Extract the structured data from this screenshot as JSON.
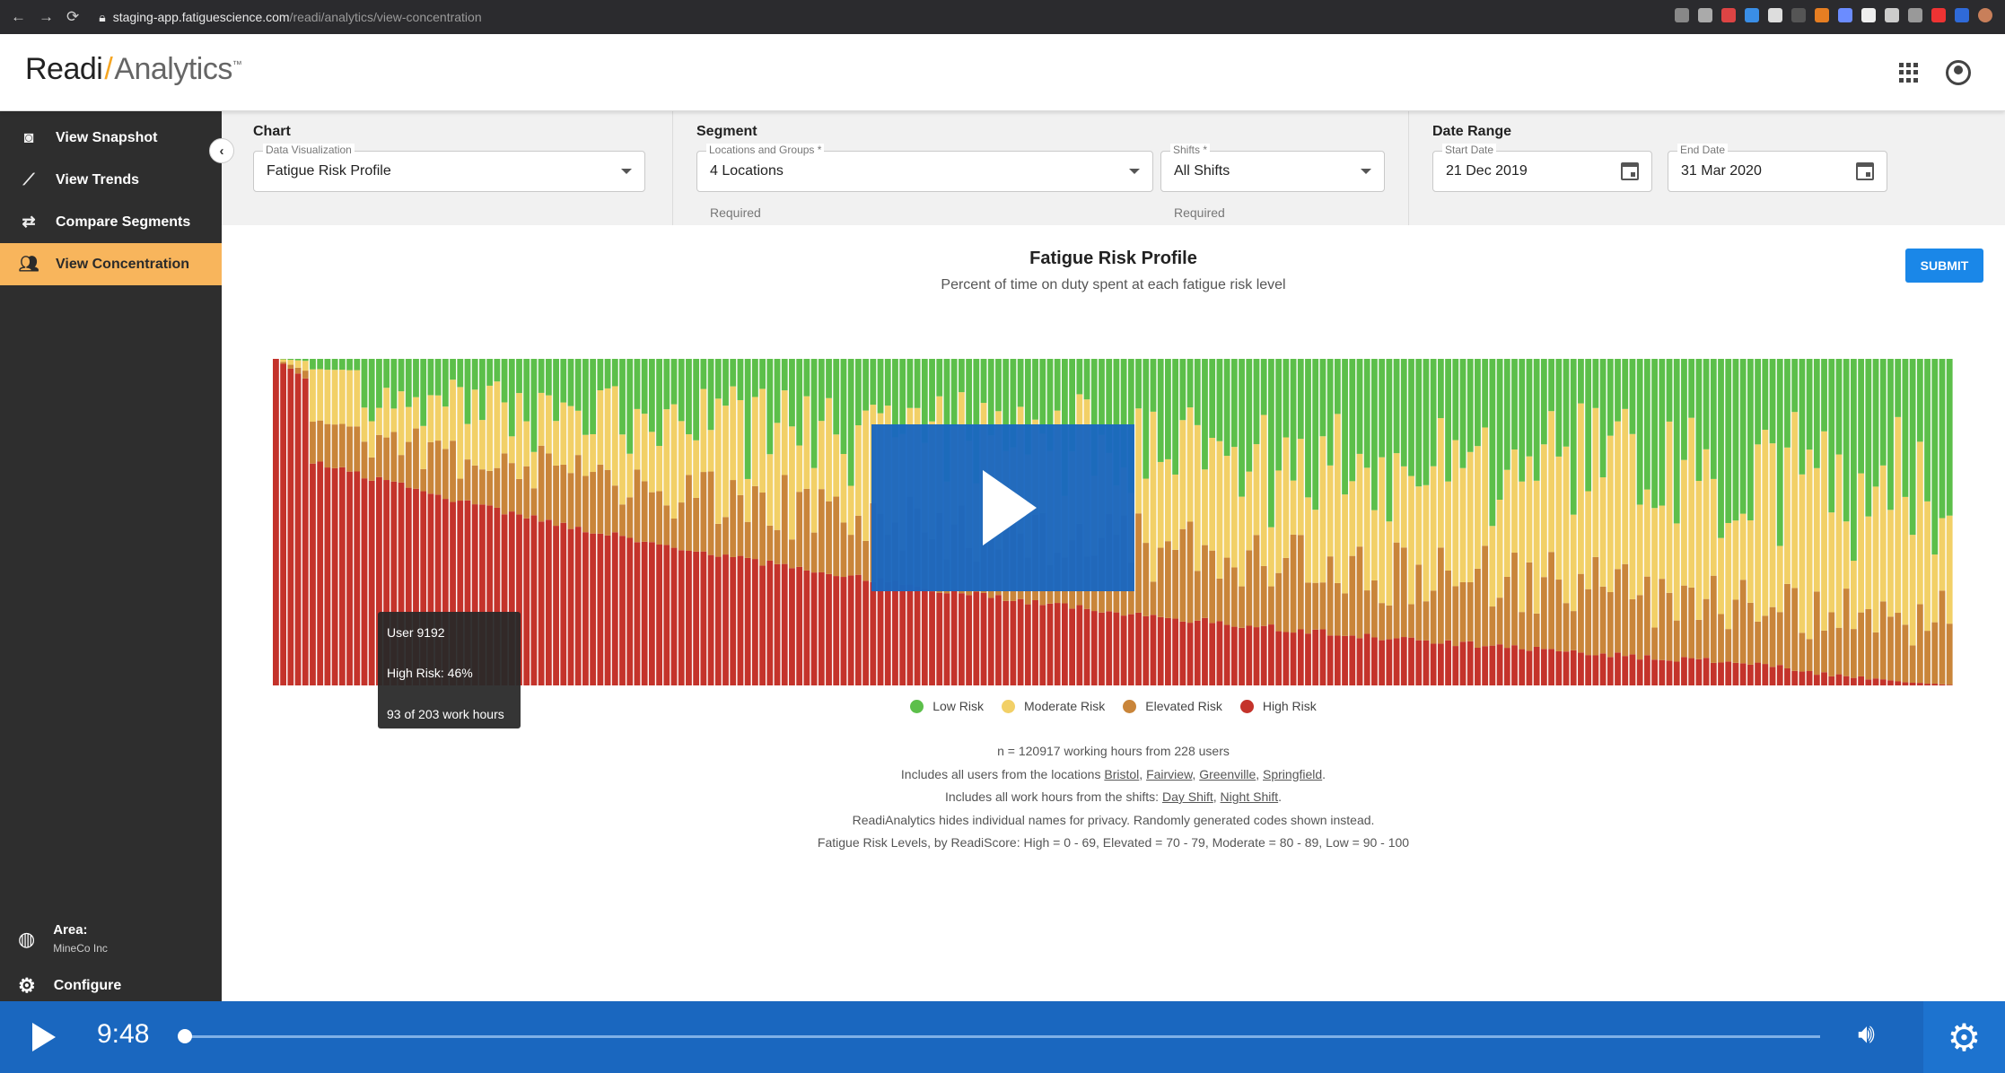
{
  "browser": {
    "url_host": "staging-app.fatiguescience.com",
    "url_path": "/readi/analytics/view-concentration"
  },
  "header": {
    "logo_readi": "Readi",
    "logo_analytics": "Analytics",
    "logo_tm": "™"
  },
  "sidebar": {
    "items": [
      {
        "label": "View Snapshot",
        "icon": "camera-icon"
      },
      {
        "label": "View Trends",
        "icon": "trend-icon"
      },
      {
        "label": "Compare Segments",
        "icon": "compare-icon"
      },
      {
        "label": "View Concentration",
        "icon": "people-icon",
        "active": true
      }
    ],
    "area_label": "Area:",
    "area_value": "MineCo Inc",
    "configure_label": "Configure"
  },
  "filters": {
    "chart": {
      "title": "Chart",
      "data_visualization_label": "Data Visualization",
      "data_visualization_value": "Fatigue Risk Profile"
    },
    "segment": {
      "title": "Segment",
      "locations_label": "Locations and Groups *",
      "locations_value": "4 Locations",
      "locations_helper": "Required",
      "shifts_label": "Shifts *",
      "shifts_value": "All Shifts",
      "shifts_helper": "Required"
    },
    "date_range": {
      "title": "Date Range",
      "start_label": "Start Date",
      "start_value": "21 Dec 2019",
      "end_label": "End Date",
      "end_value": "31 Mar 2020"
    }
  },
  "submit_label": "SUBMIT",
  "chart_data": {
    "type": "bar",
    "stacked": true,
    "title": "Fatigue Risk Profile",
    "subtitle": "Percent of time on duty spent at each fatigue risk level",
    "ylim": [
      0,
      100
    ],
    "user_count": 228,
    "high_risk_trend": {
      "start": 100,
      "tooltip_user_high": 46,
      "end": 0
    },
    "series": [
      {
        "name": "High Risk",
        "color": "#c4332b"
      },
      {
        "name": "Elevated Risk",
        "color": "#c9853a"
      },
      {
        "name": "Moderate Risk",
        "color": "#f2d067"
      },
      {
        "name": "Low Risk",
        "color": "#5cbf4a"
      }
    ],
    "legend_position": "bottom-center"
  },
  "legend": [
    {
      "label": "Low Risk",
      "color": "#5cbf4a"
    },
    {
      "label": "Moderate Risk",
      "color": "#f2d067"
    },
    {
      "label": "Elevated Risk",
      "color": "#c9853a"
    },
    {
      "label": "High Risk",
      "color": "#c4332b"
    }
  ],
  "notes": {
    "line1": "n = 120917 working hours from 228 users",
    "line2_prefix": "Includes all users from the locations",
    "locations": [
      "Bristol",
      "Fairview",
      "Greenville",
      "Springfield"
    ],
    "line3_prefix": "Includes all work hours from the shifts:",
    "shifts": [
      "Day Shift",
      "Night Shift"
    ],
    "line4": "ReadiAnalytics hides individual names for privacy. Randomly generated codes shown instead.",
    "line5": "Fatigue Risk Levels, by ReadiScore: High = 0 - 69, Elevated = 70 - 79, Moderate = 80 - 89, Low = 90 - 100"
  },
  "tooltip": {
    "user": "User 9192",
    "high_risk": "High Risk: 46%",
    "hours": "93 of 203 work hours"
  },
  "player": {
    "time": "9:48",
    "progress": 0.005
  }
}
